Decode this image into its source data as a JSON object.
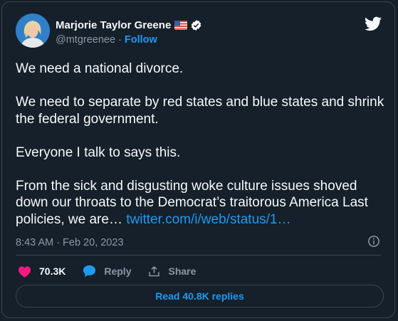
{
  "author": {
    "name": "Marjorie Taylor Greene",
    "handle": "@mtgreenee",
    "separator": "·",
    "follow_label": "Follow"
  },
  "tweet": {
    "paragraphs": [
      "We need a national divorce.",
      "We need to separate by red states and blue states and shrink the federal government.",
      "Everyone I talk to says this.",
      "From the sick and disgusting woke culture issues shoved down our throats to the Democrat’s traitorous America Last policies, we are…"
    ],
    "link_text": "twitter.com/i/web/status/1…",
    "time": "8:43 AM",
    "date_separator": "·",
    "date": "Feb 20, 2023"
  },
  "actions": {
    "likes": "70.3K",
    "reply_label": "Reply",
    "share_label": "Share"
  },
  "read_replies_label": "Read 40.8K replies",
  "colors": {
    "background": "#15202b",
    "accent": "#1d9bf0",
    "like": "#f91880",
    "muted": "#8b98a5",
    "border": "#38444d"
  },
  "icons": [
    "avatar",
    "us-flag-icon",
    "verified-icon",
    "twitter-bird-icon",
    "info-icon",
    "heart-icon",
    "reply-bubble-icon",
    "share-icon"
  ]
}
